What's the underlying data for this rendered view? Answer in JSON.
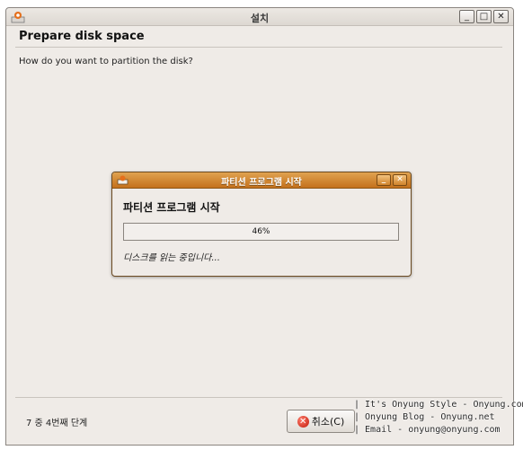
{
  "window": {
    "title": "설치",
    "app_icon": "ubuntu-installer-icon",
    "minimize_glyph": "_",
    "maximize_glyph": "□",
    "close_glyph": "✕"
  },
  "page": {
    "title": "Prepare disk space",
    "question": "How do you want to partition the disk?"
  },
  "dialog": {
    "title": "파티션 프로그램 시작",
    "heading": "파티션 프로그램 시작",
    "progress_percent": 46,
    "progress_label": "46%",
    "status": "디스크를 읽는 중입니다...",
    "minimize_glyph": "_",
    "close_glyph": "✕"
  },
  "footer": {
    "step": "7 중 4번째 단계",
    "cancel_label": "취소(C)",
    "cancel_icon_glyph": "✕"
  },
  "watermark": {
    "lines": [
      "| It's Onyung Style - Onyung.com",
      "| Onyung Blog - Onyung.net",
      "| Email - onyung@onyung.com"
    ]
  },
  "colors": {
    "window_bg": "#efebe7",
    "dialog_titlebar": "#c4711c",
    "cancel_icon": "#c01a0a"
  }
}
